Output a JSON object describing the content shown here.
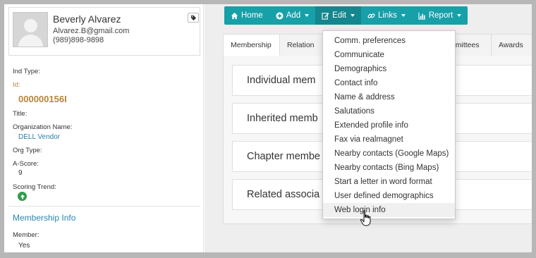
{
  "profile": {
    "name": "Beverly Alvarez",
    "email": "Alvarez.B@gmail.com",
    "phone": "(989)898-9898",
    "tag_icon": "tag-icon"
  },
  "fields": {
    "ind_type_label": "Ind Type:",
    "id_label": "Id:",
    "id_value": "000000156I",
    "title_label": "Title:",
    "org_name_label": "Organization Name:",
    "org_name_value": "DELL Vendor",
    "org_type_label": "Org Type:",
    "ascore_label": "A-Score:",
    "ascore_value": "9",
    "trend_label": "Scoring Trend:",
    "trend_icon": "arrow-up-circle-icon",
    "membership_info_heading": "Membership Info",
    "member_label": "Member:",
    "member_value": "Yes"
  },
  "toolbar": {
    "home": "Home",
    "add": "Add",
    "edit": "Edit",
    "links": "Links",
    "report": "Report"
  },
  "tabs": [
    "Membership",
    "Relation",
    "mmittees",
    "Awards"
  ],
  "cards": [
    "Individual mem",
    "Inherited memb",
    "Chapter membe",
    "Related associa"
  ],
  "edit_menu": [
    "Comm. preferences",
    "Communicate",
    "Demographics",
    "Contact info",
    "Name & address",
    "Salutations",
    "Extended profile info",
    "Fax via realmagnet",
    "Nearby contacts (Google Maps)",
    "Nearby contacts (Bing Maps)",
    "Start a letter in word format",
    "User defined demographics",
    "Web login info"
  ],
  "colors": {
    "toolbar": "#17a0a8",
    "toolbar_active": "#14868d",
    "link": "#2a7fa3",
    "id_accent": "#b5853d",
    "trend_green": "#2e9e47"
  }
}
